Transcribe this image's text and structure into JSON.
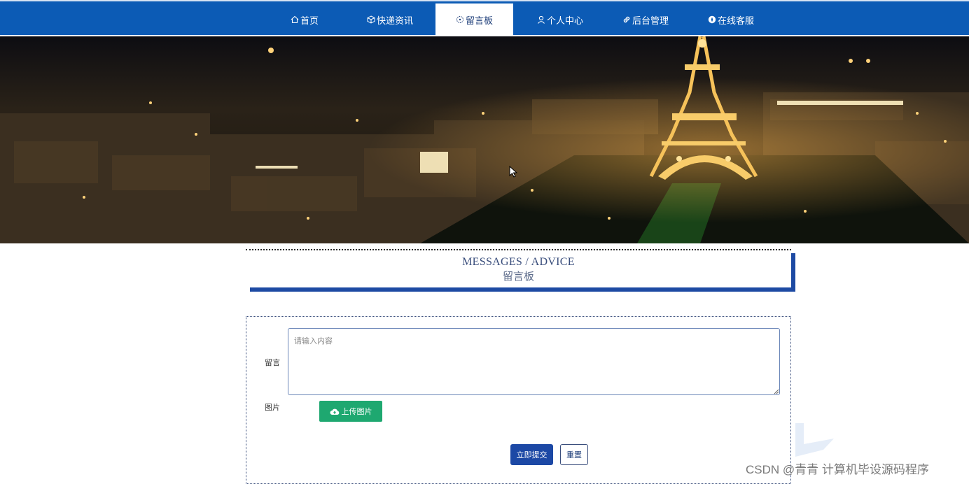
{
  "nav": {
    "items": [
      {
        "label": "首页",
        "icon": "home-icon"
      },
      {
        "label": "快递资讯",
        "icon": "cube-icon"
      },
      {
        "label": "留言板",
        "icon": "message-icon",
        "active": true
      },
      {
        "label": "个人中心",
        "icon": "user-icon"
      },
      {
        "label": "后台管理",
        "icon": "link-icon"
      },
      {
        "label": "在线客服",
        "icon": "compass-icon"
      }
    ],
    "bg_color": "#0c5bb5",
    "active_bg_color": "#ffffff"
  },
  "section": {
    "title_en": "MESSAGES / ADVICE",
    "title_cn": "留言板"
  },
  "form": {
    "message_label": "留言",
    "message_placeholder": "请输入内容",
    "message_value": "",
    "image_label": "图片",
    "upload_label": "上传图片",
    "upload_icon": "cloud-upload-icon",
    "submit_label": "立即提交",
    "reset_label": "重置",
    "submit_color": "#1c48a5",
    "upload_color": "#1ea870"
  },
  "watermark": "CSDN @青青  计算机毕设源码程序"
}
